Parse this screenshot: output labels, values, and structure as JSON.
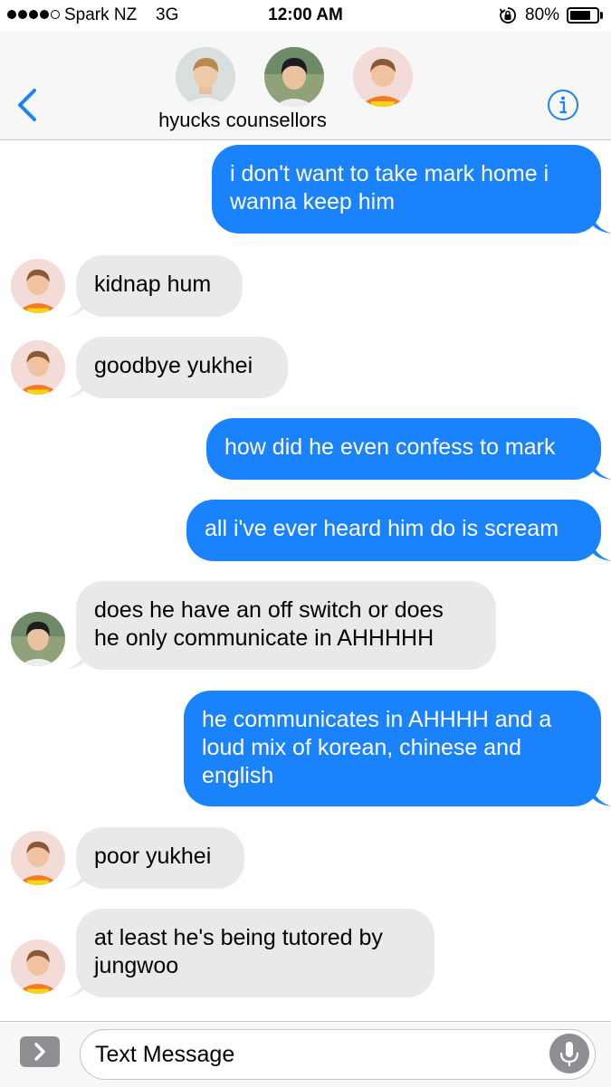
{
  "status_bar": {
    "carrier": "Spark NZ",
    "network": "3G",
    "time": "12:00 AM",
    "battery_percent": "80%",
    "battery_level": 0.8
  },
  "header": {
    "group_name": "hyucks counsellors",
    "back_icon": "chevron-left-icon",
    "info_icon": "info-icon",
    "accent_color": "#1a82fb"
  },
  "messages": [
    {
      "direction": "outgoing",
      "text": [
        "i don't want to take mark home i",
        "wanna keep him"
      ]
    },
    {
      "direction": "incoming",
      "sender_avatar": "orange-hoodie",
      "text": [
        "kidnap hum"
      ]
    },
    {
      "direction": "incoming",
      "sender_avatar": "orange-hoodie",
      "text": [
        "goodbye yukhei"
      ]
    },
    {
      "direction": "outgoing",
      "text": [
        "how did he even confess to mark"
      ]
    },
    {
      "direction": "outgoing",
      "text": [
        "all i've ever heard him do is scream"
      ]
    },
    {
      "direction": "incoming",
      "sender_avatar": "dark-hair",
      "text": [
        "does he have an off switch or does",
        "he only communicate in AHHHHH"
      ]
    },
    {
      "direction": "outgoing",
      "text": [
        "he communicates in AHHHH and a",
        "loud mix of korean, chinese and",
        "english"
      ]
    },
    {
      "direction": "incoming",
      "sender_avatar": "orange-hoodie",
      "text": [
        "poor yukhei"
      ]
    },
    {
      "direction": "incoming",
      "sender_avatar": "orange-hoodie",
      "text": [
        "at least he's being tutored by",
        "jungwoo"
      ]
    }
  ],
  "input": {
    "placeholder": "Text Message",
    "apps_icon": "chevron-right-icon",
    "mic_icon": "microphone-icon"
  },
  "colors": {
    "outgoing_bubble": "#1a82fb",
    "incoming_bubble": "#e9e9eb"
  }
}
